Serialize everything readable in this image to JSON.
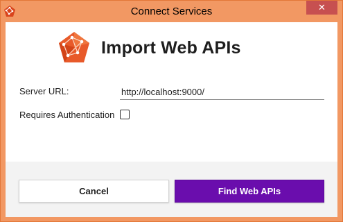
{
  "window": {
    "title": "Connect Services",
    "close_glyph": "✕",
    "app_icon": "app-logo-icon"
  },
  "header": {
    "title": "Import Web APIs",
    "logo": "web-api-logo-icon"
  },
  "form": {
    "server_url_label": "Server URL:",
    "server_url_value": "http://localhost:9000/",
    "auth_label": "Requires Authentication",
    "auth_checked": false
  },
  "footer": {
    "cancel_label": "Cancel",
    "find_label": "Find Web APIs"
  },
  "colors": {
    "title_bar": "#f29863",
    "close_button": "#c75050",
    "primary_button": "#6a0dad",
    "logo": "#e85a2a"
  }
}
